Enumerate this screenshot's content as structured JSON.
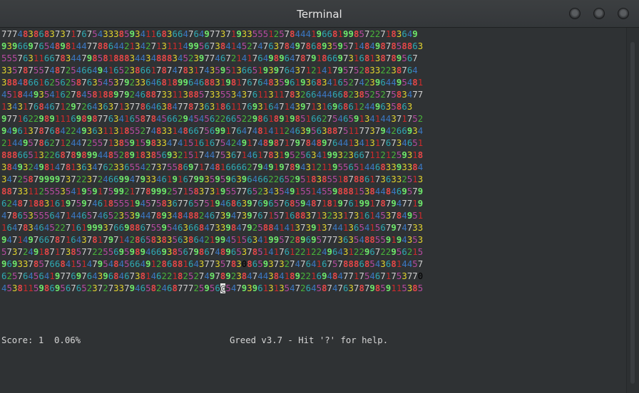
{
  "window": {
    "title": "Terminal"
  },
  "game": {
    "grid_rows": [
      "777483868373717675433385934116836647649773719335551257844419668199857227183649",
      "9396697654898144778864421342713111499567384145274763784978689359571484987858863",
      "555763116678344798581888344348883452397746721417649896478791866973168138789567",
      "335787557487254664941652386617874783174359513665193976437121417957528332238764",
      "3884866162562587635453792336468189964688319817676483596193683416527423964495481",
      "4518449354162784581889792468873311388573355343761131178326644466823852527583477",
      "13431768467129726436371377864638477873631861176931647143971316968612449635863",
      "9771622989111698987763416587845662945456226652298618919851662754659134144371752",
      "9496137876842249363113185527483314866756991764748141124639563887511773794266934",
      "2144957862712447255713859159833474151616754249174898717978489764413413176734651",
      "8886651322687898994485289183856932151744753671461783195256341993236671121259318",
      "3849324981478136347623365542737558697174816666279491978943121195565144683393384",
      "3472587999973722372466994793346191679935959639646622652951838551878861736332513",
      "8873311255535419591759921778999257158373195577652343549155145598881538448469579",
      "6248718831619759746185551945758367765751946863976965768594871819761991787947719",
      "4786535556471446574652353944789348488246739473976715716883713233173161453784951",
      "1647834645227161999376698867559546366847339847925884141373913744136541567974733",
      "9471497667871643781797142865838356386421994515634199572896957773635488559194353",
      "5737249187173857722556959894669385679867489653785141761221224964312296722956215",
      "9693378576684151479548456649128688164377357830865937327476416757888685436814457",
      "6257645641977697643968467381462218252749789238474438418922169484771754671753770",
      "4538115986956765237273379465824687772595695479396131354726458747637879859115385"
    ],
    "cursor": {
      "row": 21,
      "col": 41
    },
    "score_line": "Score: 1  0.06%",
    "help_line": "Greed v3.7 - Hit '?' for help."
  },
  "colors": {
    "background": "#2f3234",
    "digit_1": "#cc2b2b",
    "digit_2": "#48b33a",
    "digit_3": "#e3d42e",
    "digit_4": "#3b78c3",
    "digit_5": "#b74aa0",
    "digit_6": "#2fa9b3",
    "digit_7": "#cfcfcf",
    "digit_8": "#e54747",
    "digit_9": "#6ee96b"
  }
}
